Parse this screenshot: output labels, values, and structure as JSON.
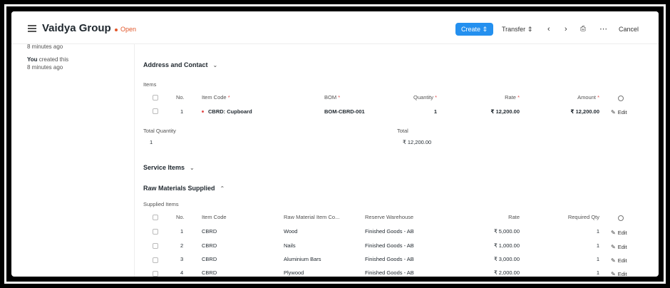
{
  "header": {
    "title": "Vaidya Group",
    "status": "Open",
    "create_label": "Create",
    "transfer_label": "Transfer",
    "cancel_label": "Cancel"
  },
  "sidebar": {
    "time1": "8 minutes ago",
    "activity_actor": "You",
    "activity_text": "created this",
    "time2": "8 minutes ago"
  },
  "address_section": {
    "title": "Address and Contact"
  },
  "items": {
    "label": "Items",
    "columns": {
      "no": "No.",
      "item_code": "Item Code",
      "bom": "BOM",
      "quantity": "Quantity",
      "rate": "Rate",
      "amount": "Amount"
    },
    "rows": [
      {
        "no": "1",
        "item_code": "CBRD: Cupboard",
        "bom": "BOM-CBRD-001",
        "quantity": "1",
        "rate": "₹ 12,200.00",
        "amount": "₹ 12,200.00",
        "edit": "Edit"
      }
    ],
    "total_quantity_label": "Total Quantity",
    "total_quantity": "1",
    "total_label": "Total",
    "total": "₹ 12,200.00"
  },
  "service_section": {
    "title": "Service Items"
  },
  "raw_section": {
    "title": "Raw Materials Supplied"
  },
  "supplied": {
    "label": "Supplied Items",
    "columns": {
      "no": "No.",
      "item_code": "Item Code",
      "raw_material": "Raw Material Item Co...",
      "warehouse": "Reserve Warehouse",
      "rate": "Rate",
      "required_qty": "Required Qty"
    },
    "rows": [
      {
        "no": "1",
        "item_code": "CBRD",
        "raw_material": "Wood",
        "warehouse": "Finished Goods - AB",
        "rate": "₹ 5,000.00",
        "required_qty": "1",
        "edit": "Edit"
      },
      {
        "no": "2",
        "item_code": "CBRD",
        "raw_material": "Nails",
        "warehouse": "Finished Goods - AB",
        "rate": "₹ 1,000.00",
        "required_qty": "1",
        "edit": "Edit"
      },
      {
        "no": "3",
        "item_code": "CBRD",
        "raw_material": "Aluminium Bars",
        "warehouse": "Finished Goods - AB",
        "rate": "₹ 3,000.00",
        "required_qty": "1",
        "edit": "Edit"
      },
      {
        "no": "4",
        "item_code": "CBRD",
        "raw_material": "Plywood",
        "warehouse": "Finished Goods - AB",
        "rate": "₹ 2,000.00",
        "required_qty": "1",
        "edit": "Edit"
      }
    ]
  }
}
